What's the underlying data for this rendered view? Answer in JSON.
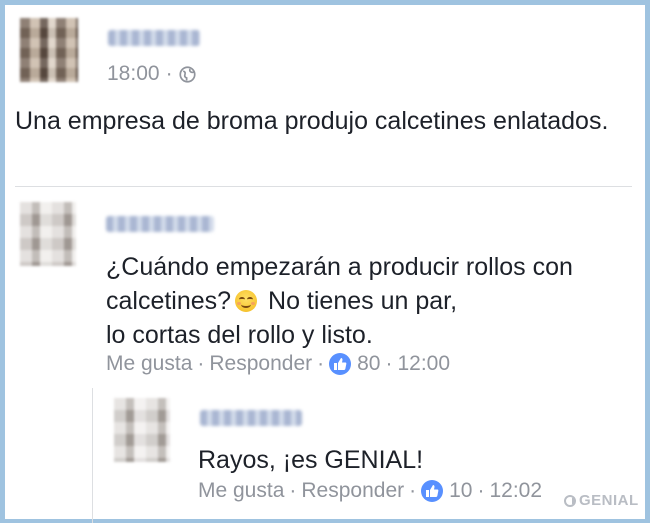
{
  "post": {
    "time": "18:00",
    "privacy_separator": "·",
    "text": "Una empresa de broma produjo calcetines enlatados."
  },
  "comment": {
    "text_line1": "¿Cuándo empezarán a producir rollos con",
    "text_line2_a": "calcetines?",
    "text_line2_b": "No tienes un par,",
    "text_line3": "lo cortas del rollo y listo.",
    "like_label": "Me gusta",
    "reply_label": "Responder",
    "likes": "80",
    "time": "12:00",
    "separator": "·"
  },
  "reply": {
    "text": "Rayos, ¡es GENIAL!",
    "like_label": "Me gusta",
    "reply_label": "Responder",
    "likes": "10",
    "time": "12:02",
    "separator": "·"
  },
  "watermark": "GENIAL",
  "colors": {
    "border": "#9fc3e0",
    "like_blue": "#5890ff",
    "meta_gray": "#90949c",
    "text": "#1d2129"
  },
  "icons": {
    "privacy": "globe-icon",
    "like": "thumbs-up-icon",
    "emoji": "smiling-face-icon"
  }
}
